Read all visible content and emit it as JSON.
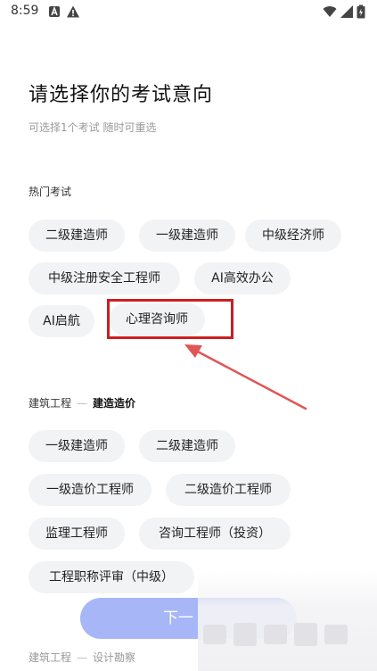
{
  "status_bar": {
    "time": "8:59"
  },
  "header": {
    "title": "请选择你的考试意向",
    "subtitle": "可选择1个考试 随时可重选"
  },
  "hot_section": {
    "label": "热门考试",
    "chips": [
      "二级建造师",
      "一级建造师",
      "中级经济师",
      "中级注册安全工程师",
      "AI高效办公",
      "AI启航",
      "心理咨询师"
    ]
  },
  "construction_cost_section": {
    "label_main": "建筑工程",
    "label_separator": "—",
    "label_sub": "建造造价",
    "chips": [
      "一级建造师",
      "二级建造师",
      "一级造价工程师",
      "二级造价工程师",
      "监理工程师",
      "咨询工程师（投资）",
      "工程职称评审（中级）"
    ]
  },
  "design_section": {
    "label_main": "建筑工程",
    "label_separator": "—",
    "label_sub": "设计勘察"
  },
  "footer": {
    "next_label": "下一"
  },
  "annotation": {
    "highlight_color": "#cc1f1f",
    "arrow_color": "#e05555"
  }
}
